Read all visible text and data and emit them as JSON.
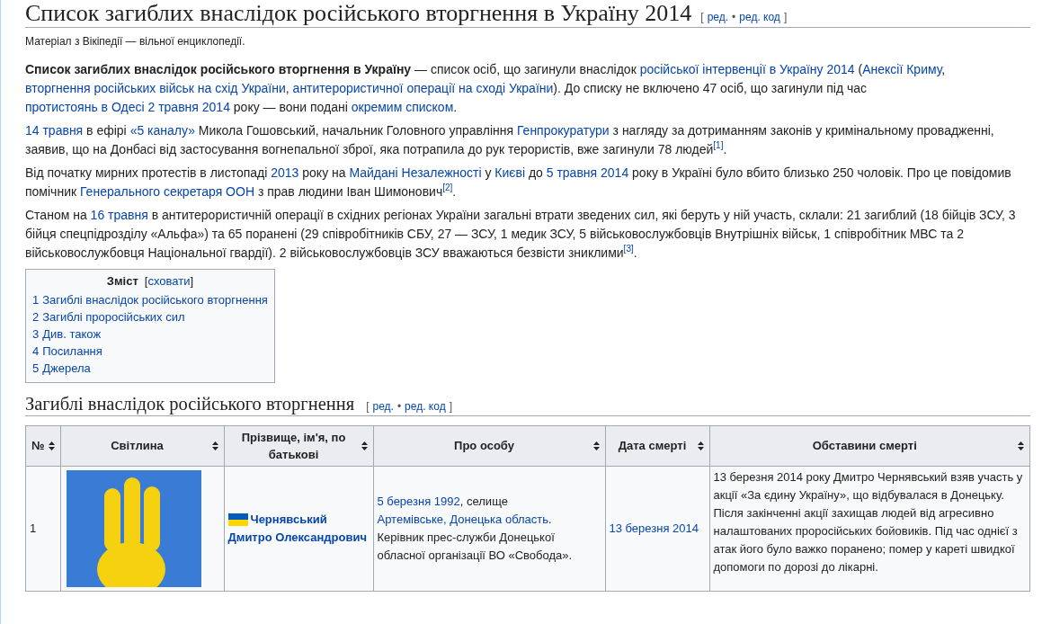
{
  "page_title": {
    "text": "Список загиблих внаслідок російського вторгнення в Україну 2014",
    "edit": {
      "open": "[",
      "links": [
        "ред.",
        "ред. код"
      ],
      "separator": "•",
      "close": "]"
    }
  },
  "tagline": "Матеріал з Вікіпедії — вільної енциклопедії.",
  "paragraphs": [
    {
      "parts": [
        {
          "kind": "bold",
          "text": "Список загиблих внаслідок російського вторгнення в Україну"
        },
        {
          "kind": "text",
          "text": " — список осіб, що загинули внаслідок "
        },
        {
          "kind": "link",
          "text": "російської інтервенції в Україну 2014"
        },
        {
          "kind": "text",
          "text": " ("
        },
        {
          "kind": "link",
          "text": "Анексії Криму"
        },
        {
          "kind": "text",
          "text": ", "
        },
        {
          "kind": "link",
          "text": "вторгнення російських військ на схід України"
        },
        {
          "kind": "text",
          "text": ", "
        },
        {
          "kind": "link",
          "text": "антитерористичної операції на сході України"
        },
        {
          "kind": "text",
          "text": "). До списку не включено 47 осіб, що загинули під час "
        },
        {
          "kind": "link",
          "text": "протистоянь в Одесі 2 травня 2014"
        },
        {
          "kind": "text",
          "text": " року — вони подані "
        },
        {
          "kind": "link",
          "text": "окремим списком"
        },
        {
          "kind": "text",
          "text": "."
        }
      ]
    },
    {
      "parts": [
        {
          "kind": "link",
          "text": "14 травня"
        },
        {
          "kind": "text",
          "text": " в ефірі "
        },
        {
          "kind": "link",
          "text": "«5 каналу»"
        },
        {
          "kind": "text",
          "text": " Микола Гошовський, начальник Головного управління "
        },
        {
          "kind": "link",
          "text": "Генпрокуратури"
        },
        {
          "kind": "text",
          "text": " з нагляду за дотриманням законів у кримінальному провадженні, заявив, що на Донбасі від застосування вогнепальної зброї, яка потрапила до рук терористів, вже загинули 78 людей"
        },
        {
          "kind": "ref",
          "text": "[1]"
        },
        {
          "kind": "text",
          "text": "."
        }
      ]
    },
    {
      "parts": [
        {
          "kind": "text",
          "text": "Від початку мирних протестів в листопаді "
        },
        {
          "kind": "link",
          "text": "2013"
        },
        {
          "kind": "text",
          "text": " року на "
        },
        {
          "kind": "link",
          "text": "Майдані Незалежності"
        },
        {
          "kind": "text",
          "text": " у "
        },
        {
          "kind": "link",
          "text": "Києві"
        },
        {
          "kind": "text",
          "text": " до "
        },
        {
          "kind": "link",
          "text": "5 травня 2014"
        },
        {
          "kind": "text",
          "text": " року в Україні було вбито близько 250 чоловік. Про це повідомив помічник "
        },
        {
          "kind": "link",
          "text": "Генерального секретаря ООН"
        },
        {
          "kind": "text",
          "text": " з прав людини Іван Шимонович"
        },
        {
          "kind": "ref",
          "text": "[2]"
        },
        {
          "kind": "text",
          "text": "."
        }
      ]
    },
    {
      "parts": [
        {
          "kind": "text",
          "text": "Станом на "
        },
        {
          "kind": "link",
          "text": "16 травня"
        },
        {
          "kind": "text",
          "text": " в антитерористичній операції в східних регіонах України загальні втрати зведених сил, які беруть у ній участь, склали: 21 загиблий (18 бійців ЗСУ, 3 бійця спецпідрозділу «Альфа») та 65 поранені (29 співробітників СБУ, 27 — ЗСУ, 1 медик ЗСУ, 5 військовослужбовців Внутрішніх військ, 1 співробітник МВС та 2 військовослужбовця Національної гвардії). 2 військовослужбовців ЗСУ вважаються безвісти зниклими"
        },
        {
          "kind": "ref",
          "text": "[3]"
        },
        {
          "kind": "text",
          "text": "."
        }
      ]
    }
  ],
  "toc": {
    "title": "Зміст",
    "toggle_open": "[",
    "toggle": "сховати",
    "toggle_close": "]",
    "items": [
      {
        "number": "1",
        "label": "Загиблі внаслідок російського вторгнення"
      },
      {
        "number": "2",
        "label": "Загиблі проросійських сил"
      },
      {
        "number": "3",
        "label": "Див. також"
      },
      {
        "number": "4",
        "label": "Посилання"
      },
      {
        "number": "5",
        "label": "Джерела"
      }
    ]
  },
  "section": {
    "heading": "Загиблі внаслідок російського вторгнення",
    "edit": {
      "open": "[",
      "links": [
        "ред.",
        "ред. код"
      ],
      "separator": "•",
      "close": "]"
    }
  },
  "table": {
    "columns": [
      {
        "label": "№"
      },
      {
        "label": "Світлина"
      },
      {
        "label": "Прізвище, ім'я, по батькові"
      },
      {
        "label": "Про особу"
      },
      {
        "label": "Дата смерті"
      },
      {
        "label": "Обставини смерті"
      }
    ],
    "rows": [
      {
        "number": "1",
        "name": "Чернявський Дмитро Олександрович",
        "about": [
          {
            "kind": "link",
            "text": "5 березня 1992"
          },
          {
            "kind": "text",
            "text": ", селище "
          },
          {
            "kind": "link",
            "text": "Артемівське, Донецька область"
          },
          {
            "kind": "text",
            "text": ". Керівник прес-служби Донецької обласної організації ВО «Свобода»."
          }
        ],
        "date": "13 березня 2014",
        "circumstances": "13 березня 2014 року Дмитро Чернявський взяв участь у акції «За єдину Україну», що відбувалася в Донецьку. Після закінченні акції захищав людей від агресивно налаштованих проросійських бойовиків. Під час однієї з атак його було важко поранено; помер у кареті швидкої допомоги по дорозі до лікарні."
      }
    ]
  }
}
